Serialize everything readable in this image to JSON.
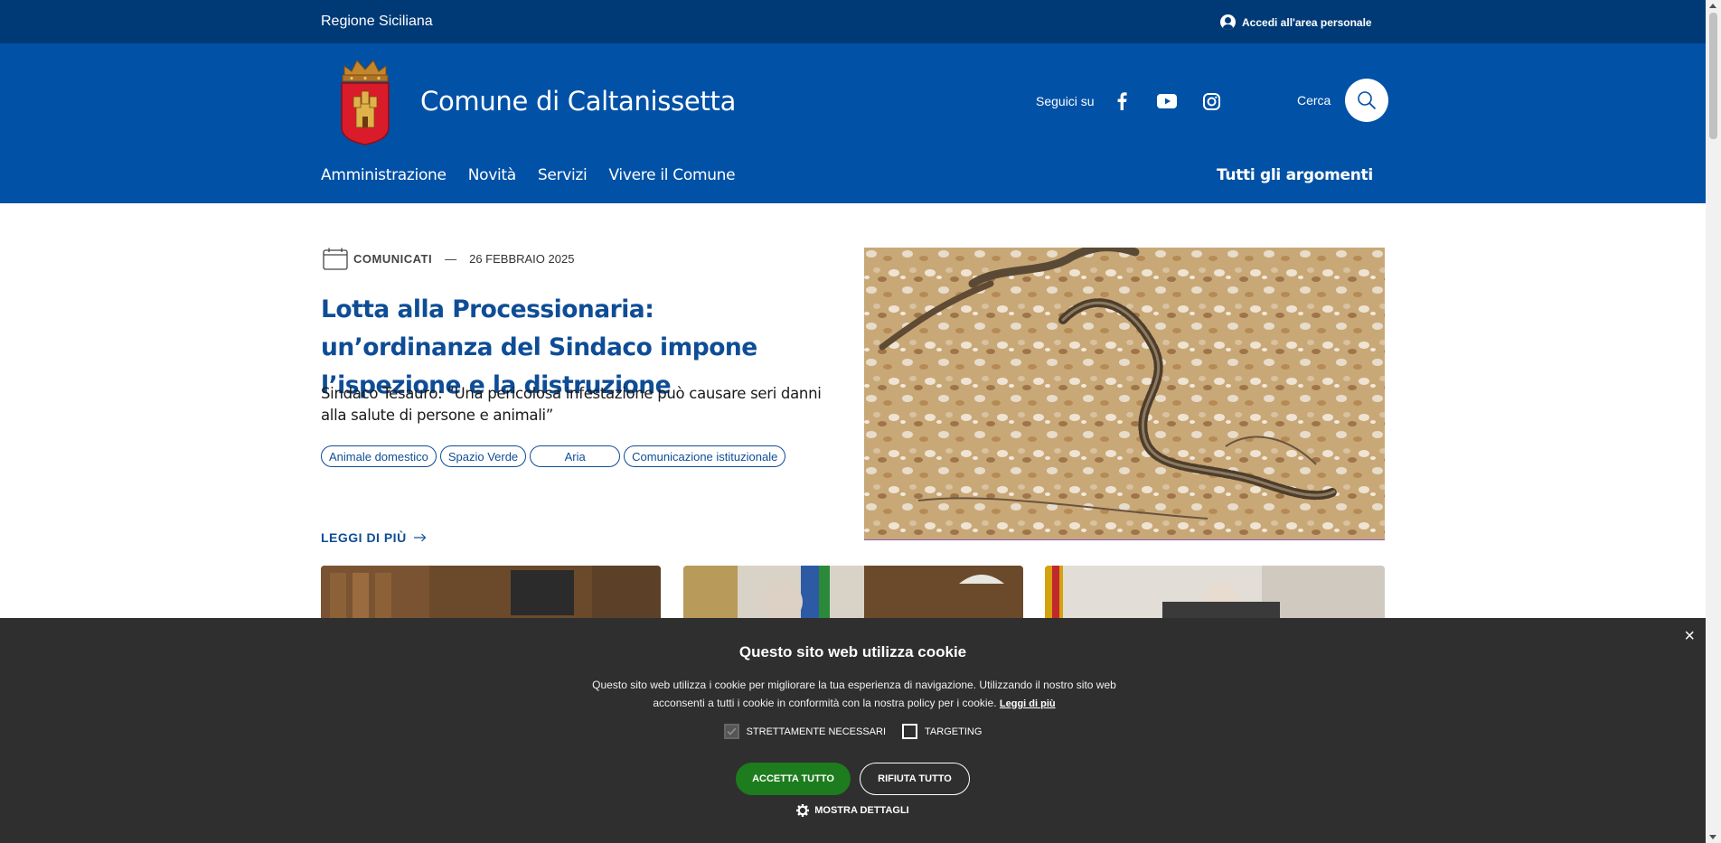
{
  "slim_header": {
    "region": "Regione Siciliana",
    "login": "Accedi all'area personale"
  },
  "header": {
    "site_name": "Comune di Caltanissetta",
    "follow_label": "Seguici su",
    "social": [
      "facebook-icon",
      "youtube-icon",
      "instagram-icon"
    ],
    "search_label": "Cerca"
  },
  "nav": {
    "items": [
      "Amministrazione",
      "Novità",
      "Servizi",
      "Vivere il Comune"
    ],
    "right": "Tutti gli argomenti"
  },
  "hero": {
    "category": "COMUNICATI",
    "date": "26 FEBBRAIO 2025",
    "title": "Lotta alla Processionaria: un’ordinanza del Sindaco impone l’ispezione e la distruzione",
    "subtitle": "Sindaco Tesauro: “Una pericolosa infestazione può causare seri danni alla salute di persone e animali”",
    "tags": [
      "Animale domestico",
      "Spazio Verde",
      "Aria",
      "Comunicazione istituzionale"
    ],
    "read_more": "LEGGI DI PIÙ"
  },
  "cookie": {
    "title": "Questo sito web utilizza cookie",
    "body": "Questo sito web utilizza i cookie per migliorare la tua esperienza di navigazione. Utilizzando il nostro sito web acconsenti a tutti i cookie in conformità con la nostra policy per i cookie.",
    "link": "Leggi di più",
    "check_necessary": "STRETTAMENTE NECESSARI",
    "check_targeting": "TARGETING",
    "accept": "ACCETTA TUTTO",
    "reject": "RIFIUTA TUTTO",
    "details": "MOSTRA DETTAGLI",
    "close": "×"
  },
  "colors": {
    "slim_header": "#003a76",
    "header": "#0151a6",
    "link": "#0e4d96",
    "cookie_bg": "#2f2f2f",
    "accept": "#1d7c1d"
  }
}
